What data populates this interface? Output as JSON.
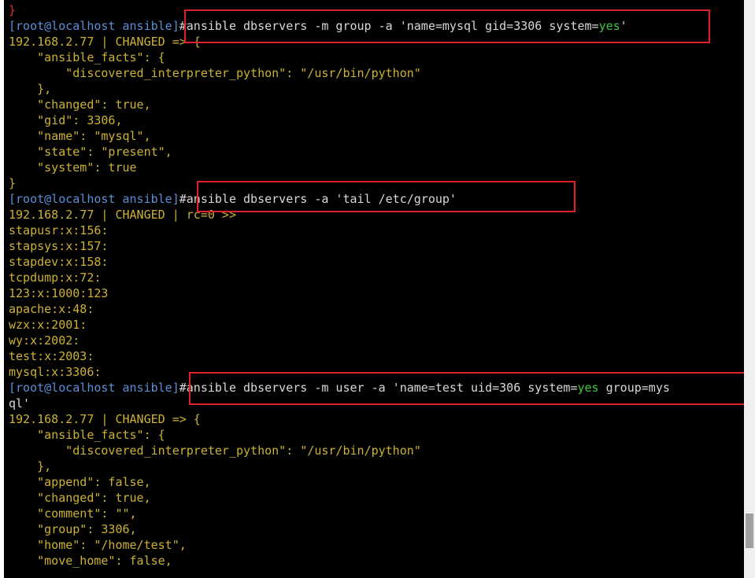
{
  "colors": {
    "background": "#000000",
    "prompt": "#5a8fd8",
    "text": "#d8d8d8",
    "output": "#cdb232",
    "keyword": "#3fc93f",
    "brace": "#e03030",
    "highlight": "#e0202a"
  },
  "terminal": {
    "lines": [
      {
        "segments": [
          {
            "t": "}",
            "c": "brace"
          }
        ]
      },
      {
        "segments": [
          {
            "t": "[root@localhost ansible]",
            "c": "prompt"
          },
          {
            "t": "#ansible dbservers -m group -a 'name=mysql gid=3306 system=",
            "c": "text"
          },
          {
            "t": "yes",
            "c": "keyword"
          },
          {
            "t": "'",
            "c": "text"
          }
        ]
      },
      {
        "segments": [
          {
            "t": "192.168.2.77 | CHANGED => {",
            "c": "output"
          }
        ]
      },
      {
        "segments": [
          {
            "t": "    \"ansible_facts\": {",
            "c": "output"
          }
        ]
      },
      {
        "segments": [
          {
            "t": "        \"discovered_interpreter_python\": \"/usr/bin/python\"",
            "c": "output"
          }
        ]
      },
      {
        "segments": [
          {
            "t": "    },",
            "c": "output"
          }
        ]
      },
      {
        "segments": [
          {
            "t": "    \"changed\": true,",
            "c": "output"
          }
        ]
      },
      {
        "segments": [
          {
            "t": "    \"gid\": 3306,",
            "c": "output"
          }
        ]
      },
      {
        "segments": [
          {
            "t": "    \"name\": \"mysql\",",
            "c": "output"
          }
        ]
      },
      {
        "segments": [
          {
            "t": "    \"state\": \"present\",",
            "c": "output"
          }
        ]
      },
      {
        "segments": [
          {
            "t": "    \"system\": true",
            "c": "output"
          }
        ]
      },
      {
        "segments": [
          {
            "t": "}",
            "c": "output"
          }
        ]
      },
      {
        "segments": [
          {
            "t": "[root@localhost ansible]",
            "c": "prompt"
          },
          {
            "t": "#ansible dbservers -a 'tail /etc/group'",
            "c": "text"
          }
        ]
      },
      {
        "segments": [
          {
            "t": "192.168.2.77 | CHANGED | rc=0 >>",
            "c": "output"
          }
        ]
      },
      {
        "segments": [
          {
            "t": "stapusr:x:156:",
            "c": "output"
          }
        ]
      },
      {
        "segments": [
          {
            "t": "stapsys:x:157:",
            "c": "output"
          }
        ]
      },
      {
        "segments": [
          {
            "t": "stapdev:x:158:",
            "c": "output"
          }
        ]
      },
      {
        "segments": [
          {
            "t": "tcpdump:x:72:",
            "c": "output"
          }
        ]
      },
      {
        "segments": [
          {
            "t": "123:x:1000:123",
            "c": "output"
          }
        ]
      },
      {
        "segments": [
          {
            "t": "apache:x:48:",
            "c": "output"
          }
        ]
      },
      {
        "segments": [
          {
            "t": "wzx:x:2001:",
            "c": "output"
          }
        ]
      },
      {
        "segments": [
          {
            "t": "wy:x:2002:",
            "c": "output"
          }
        ]
      },
      {
        "segments": [
          {
            "t": "test:x:2003:",
            "c": "output"
          }
        ]
      },
      {
        "segments": [
          {
            "t": "mysql:x:3306:",
            "c": "output"
          }
        ]
      },
      {
        "segments": [
          {
            "t": "[root@localhost ansible]",
            "c": "prompt"
          },
          {
            "t": "#ansible dbservers -m user -a 'name=test uid=306 system=",
            "c": "text"
          },
          {
            "t": "yes",
            "c": "keyword"
          },
          {
            "t": " group=mys",
            "c": "text"
          }
        ]
      },
      {
        "segments": [
          {
            "t": "ql'",
            "c": "text"
          }
        ]
      },
      {
        "segments": [
          {
            "t": "192.168.2.77 | CHANGED => {",
            "c": "output"
          }
        ]
      },
      {
        "segments": [
          {
            "t": "    \"ansible_facts\": {",
            "c": "output"
          }
        ]
      },
      {
        "segments": [
          {
            "t": "        \"discovered_interpreter_python\": \"/usr/bin/python\"",
            "c": "output"
          }
        ]
      },
      {
        "segments": [
          {
            "t": "    },",
            "c": "output"
          }
        ]
      },
      {
        "segments": [
          {
            "t": "    \"append\": false,",
            "c": "output"
          }
        ]
      },
      {
        "segments": [
          {
            "t": "    \"changed\": true,",
            "c": "output"
          }
        ]
      },
      {
        "segments": [
          {
            "t": "    \"comment\": \"\",",
            "c": "output"
          }
        ]
      },
      {
        "segments": [
          {
            "t": "    \"group\": 3306,",
            "c": "output"
          }
        ]
      },
      {
        "segments": [
          {
            "t": "    \"home\": \"/home/test\",",
            "c": "output"
          }
        ]
      },
      {
        "segments": [
          {
            "t": "    \"move_home\": false,",
            "c": "output"
          }
        ]
      }
    ]
  }
}
